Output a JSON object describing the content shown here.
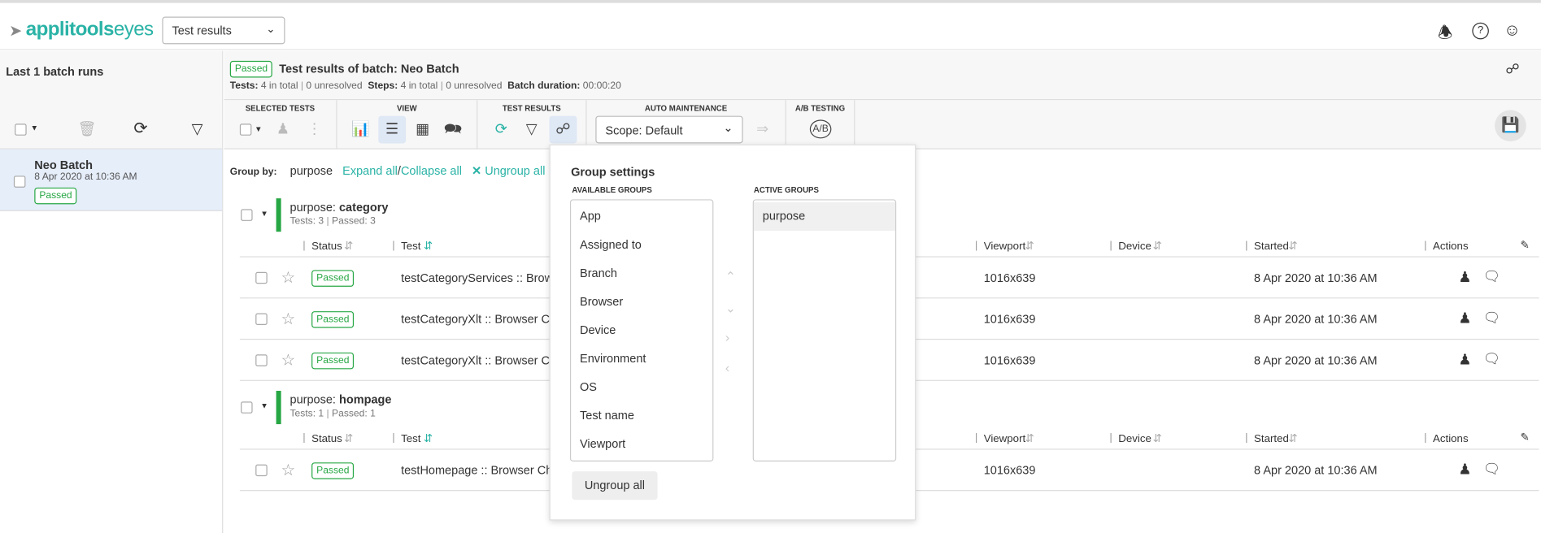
{
  "header": {
    "logo": "applitools",
    "logo_suffix": "eyes",
    "view_select": "Test results",
    "icons": [
      "bell-icon",
      "help-icon",
      "user-settings-icon"
    ]
  },
  "sidebar": {
    "title": "Last 1 batch runs",
    "batches": [
      {
        "name": "Neo Batch",
        "date": "8 Apr 2020 at 10:36 AM",
        "status": "Passed"
      }
    ]
  },
  "batch": {
    "status": "Passed",
    "title_prefix": "Test results of batch:",
    "name": "Neo Batch",
    "tests_label": "Tests:",
    "tests_total": "4 in total",
    "tests_unresolved": "0 unresolved",
    "steps_label": "Steps:",
    "steps_total": "4 in total",
    "steps_unresolved": "0 unresolved",
    "duration_label": "Batch duration:",
    "duration": "00:00:20"
  },
  "toolbar": {
    "selected_tests": "SELECTED TESTS",
    "view": "VIEW",
    "test_results": "TEST RESULTS",
    "auto_maintenance": "AUTO MAINTENANCE",
    "ab_testing": "A/B TESTING",
    "scope": "Scope: Default"
  },
  "grouping": {
    "label": "Group by:",
    "value": "purpose",
    "expand": "Expand all",
    "sep": "/",
    "collapse": "Collapse all",
    "ungroup": "Ungroup all"
  },
  "columns": {
    "status": "Status",
    "test": "Test",
    "viewport": "Viewport",
    "device": "Device",
    "started": "Started",
    "actions": "Actions"
  },
  "groups": [
    {
      "prefix": "purpose:",
      "name": "category",
      "tests": "Tests: 3",
      "passed": "Passed: 3",
      "rows": [
        {
          "status": "Passed",
          "test": "testCategoryServices :: Brows",
          "viewport": "1016x639",
          "started": "8 Apr 2020 at 10:36 AM"
        },
        {
          "status": "Passed",
          "test": "testCategoryXlt :: Browser Ch",
          "viewport": "1016x639",
          "started": "8 Apr 2020 at 10:36 AM"
        },
        {
          "status": "Passed",
          "test": "testCategoryXlt :: Browser Ch",
          "viewport": "1016x639",
          "started": "8 Apr 2020 at 10:36 AM"
        }
      ]
    },
    {
      "prefix": "purpose:",
      "name": "hompage",
      "tests": "Tests: 1",
      "passed": "Passed: 1",
      "rows": [
        {
          "status": "Passed",
          "test": "testHomepage :: Browser Chr",
          "viewport": "1016x639",
          "started": "8 Apr 2020 at 10:36 AM"
        }
      ]
    }
  ],
  "popup": {
    "title": "Group settings",
    "available_label": "AVAILABLE GROUPS",
    "active_label": "ACTIVE GROUPS",
    "available": [
      "App",
      "Assigned to",
      "Branch",
      "Browser",
      "Device",
      "Environment",
      "OS",
      "Test name",
      "Viewport"
    ],
    "active": [
      "purpose"
    ],
    "ungroup": "Ungroup all"
  },
  "colors": {
    "accent": "#2ab3a6",
    "passed": "#27a744"
  }
}
